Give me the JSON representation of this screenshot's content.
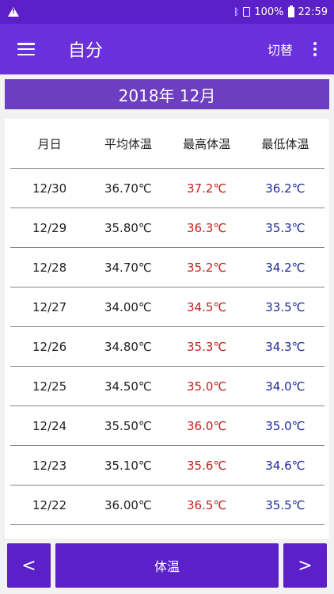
{
  "status": {
    "battery": "100%",
    "time": "22:59"
  },
  "appbar": {
    "title": "自分",
    "switch_label": "切替"
  },
  "month_label": "2018年 12月",
  "table": {
    "headers": [
      "月日",
      "平均体温",
      "最高体温",
      "最低体温"
    ],
    "rows": [
      {
        "date": "12/30",
        "avg": "36.70℃",
        "max": "37.2℃",
        "min": "36.2℃"
      },
      {
        "date": "12/29",
        "avg": "35.80℃",
        "max": "36.3℃",
        "min": "35.3℃"
      },
      {
        "date": "12/28",
        "avg": "34.70℃",
        "max": "35.2℃",
        "min": "34.2℃"
      },
      {
        "date": "12/27",
        "avg": "34.00℃",
        "max": "34.5℃",
        "min": "33.5℃"
      },
      {
        "date": "12/26",
        "avg": "34.80℃",
        "max": "35.3℃",
        "min": "34.3℃"
      },
      {
        "date": "12/25",
        "avg": "34.50℃",
        "max": "35.0℃",
        "min": "34.0℃"
      },
      {
        "date": "12/24",
        "avg": "35.50℃",
        "max": "36.0℃",
        "min": "35.0℃"
      },
      {
        "date": "12/23",
        "avg": "35.10℃",
        "max": "35.6℃",
        "min": "34.6℃"
      },
      {
        "date": "12/22",
        "avg": "36.00℃",
        "max": "36.5℃",
        "min": "35.5℃"
      }
    ]
  },
  "colors": {
    "max_text": "#c0201c",
    "min_text": "#1c2aa0",
    "accent": "#5b20c8"
  },
  "bottom": {
    "prev_label": "<",
    "temp_label": "体温",
    "next_label": ">"
  }
}
